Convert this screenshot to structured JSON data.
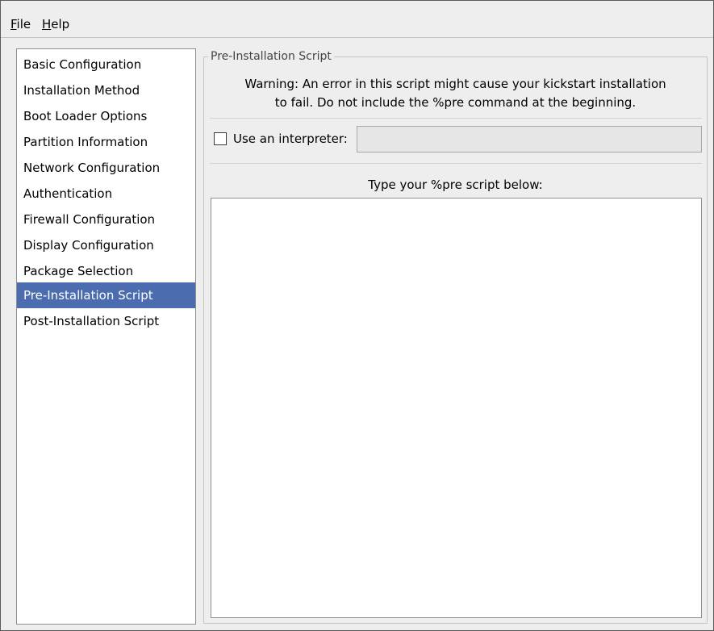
{
  "menubar": {
    "file": {
      "mnemonic": "F",
      "rest": "ile"
    },
    "help": {
      "mnemonic": "H",
      "rest": "elp"
    }
  },
  "sidebar": {
    "items": [
      {
        "label": "Basic Configuration",
        "selected": false
      },
      {
        "label": "Installation Method",
        "selected": false
      },
      {
        "label": "Boot Loader Options",
        "selected": false
      },
      {
        "label": "Partition Information",
        "selected": false
      },
      {
        "label": "Network Configuration",
        "selected": false
      },
      {
        "label": "Authentication",
        "selected": false
      },
      {
        "label": "Firewall Configuration",
        "selected": false
      },
      {
        "label": "Display Configuration",
        "selected": false
      },
      {
        "label": "Package Selection",
        "selected": false
      },
      {
        "label": "Pre-Installation Script",
        "selected": true
      },
      {
        "label": "Post-Installation Script",
        "selected": false
      }
    ]
  },
  "main": {
    "frame_title": "Pre-Installation Script",
    "warning_line1": "Warning: An error in this script might cause your kickstart installation",
    "warning_line2": "to fail. Do not include the %pre command at the beginning.",
    "interpreter_checkbox_label": "Use an interpreter:",
    "interpreter_checked": false,
    "interpreter_value": "",
    "script_prompt": "Type your %pre script below:",
    "script_value": ""
  },
  "colors": {
    "selection": "#4b6cae",
    "window_bg": "#eeeeee"
  }
}
